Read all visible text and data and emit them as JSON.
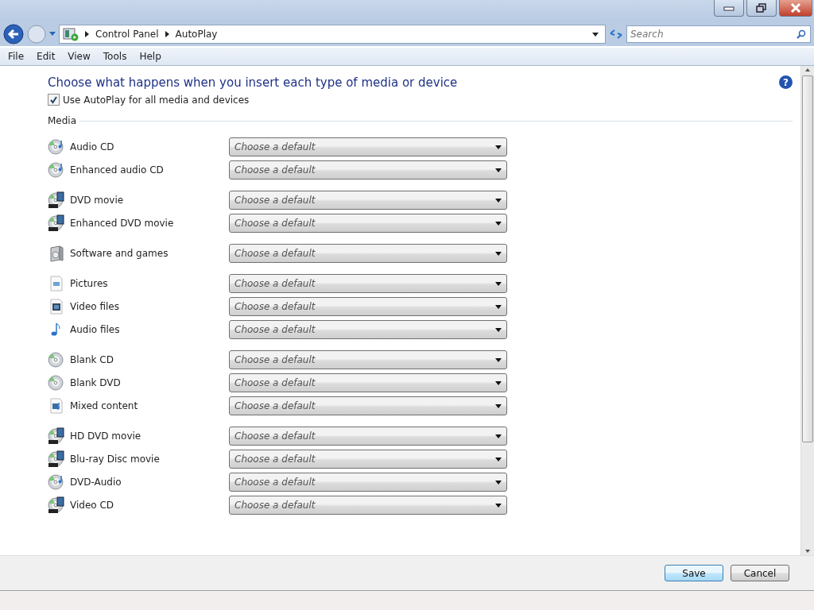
{
  "nav": {
    "breadcrumb": [
      "Control Panel",
      "AutoPlay"
    ],
    "search": {
      "placeholder": "Search"
    }
  },
  "menu": [
    "File",
    "Edit",
    "View",
    "Tools",
    "Help"
  ],
  "help": "?",
  "heading": "Choose what happens when you insert each type of media or device",
  "autoplay_all": {
    "label": "Use AutoPlay for all media and devices",
    "checked": true
  },
  "section": "Media",
  "groups": [
    {
      "items": [
        {
          "kind": "music-disc",
          "label": "Audio CD",
          "placeholder": "Choose a default"
        },
        {
          "kind": "music-disc",
          "label": "Enhanced audio CD",
          "placeholder": "Choose a default"
        }
      ]
    },
    {
      "items": [
        {
          "kind": "film-disc",
          "label": "DVD movie",
          "placeholder": "Choose a default"
        },
        {
          "kind": "film-disc",
          "label": "Enhanced DVD movie",
          "placeholder": "Choose a default"
        }
      ]
    },
    {
      "items": [
        {
          "kind": "software",
          "label": "Software and games",
          "placeholder": "Choose a default"
        }
      ]
    },
    {
      "items": [
        {
          "kind": "picture-file",
          "label": "Pictures",
          "placeholder": "Choose a default"
        },
        {
          "kind": "video-file",
          "label": "Video files",
          "placeholder": "Choose a default"
        },
        {
          "kind": "music-note",
          "label": "Audio files",
          "placeholder": "Choose a default"
        }
      ]
    },
    {
      "items": [
        {
          "kind": "disc",
          "label": "Blank CD",
          "placeholder": "Choose a default"
        },
        {
          "kind": "disc",
          "label": "Blank DVD",
          "placeholder": "Choose a default"
        },
        {
          "kind": "mixed-file",
          "label": "Mixed content",
          "placeholder": "Choose a default"
        }
      ]
    },
    {
      "items": [
        {
          "kind": "film-disc",
          "label": "HD DVD movie",
          "placeholder": "Choose a default"
        },
        {
          "kind": "film-disc",
          "label": "Blu-ray Disc movie",
          "placeholder": "Choose a default"
        },
        {
          "kind": "music-disc",
          "label": "DVD-Audio",
          "placeholder": "Choose a default"
        },
        {
          "kind": "film-disc",
          "label": "Video CD",
          "placeholder": "Choose a default"
        }
      ]
    }
  ],
  "buttons": [
    {
      "label": "Save",
      "kind": "default"
    },
    {
      "label": "Cancel",
      "kind": "normal"
    }
  ]
}
